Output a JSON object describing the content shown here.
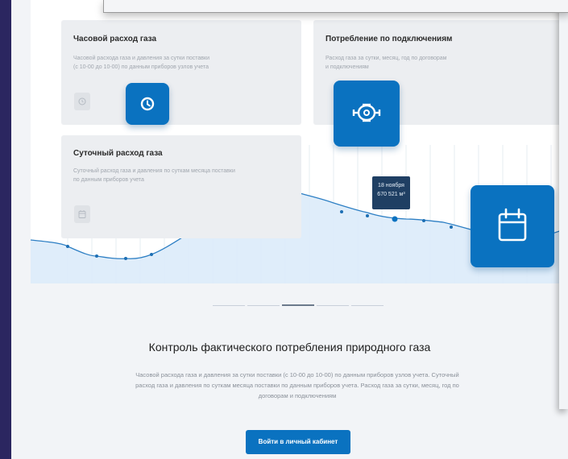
{
  "cards": {
    "hourly": {
      "title": "Часовой расход газа",
      "desc_line1": "Часовой расхода газа и давления за сутки поставки",
      "desc_line2": "(с 10-00 до 10-00) по данным приборов узлов учета"
    },
    "connections": {
      "title": "Потребление по подключениям",
      "desc_line1": "Расход газа за сутки, месяц, год по договорам",
      "desc_line2": "и подключениям"
    },
    "daily": {
      "title": "Суточный расход газа",
      "desc_line1": "Суточный расход газа и давления по суткам месяца поставки",
      "desc_line2": "по данным приборов учета"
    }
  },
  "tooltip": {
    "date": "18 ноября",
    "value": "670 521 м³"
  },
  "icons": {
    "hourly_small": "clock-icon",
    "hourly_big": "clock-icon",
    "connections_big": "gas-meter-icon",
    "daily_small": "calendar-icon",
    "daily_big": "calendar-icon"
  },
  "colors": {
    "accent": "#0a72c0",
    "tooltip_bg": "#1f3f63",
    "chart_line": "#2d7fc4",
    "chart_fill": "#dcebf9"
  },
  "carousel": {
    "count": 5,
    "active_index": 2
  },
  "section": {
    "heading": "Контроль фактического потребления природного газа",
    "para_line1": "Часовой расхода газа и давления за сутки поставки (с 10-00 до 10-00) по данным приборов узлов учета. Суточный",
    "para_line2": "расход газа и давления по суткам месяца поставки по данным приборов учета. Расход газа за сутки, месяц, год по",
    "para_line3": "договорам и подключениям"
  },
  "cta": {
    "label": "Войти в личный кабинет"
  }
}
